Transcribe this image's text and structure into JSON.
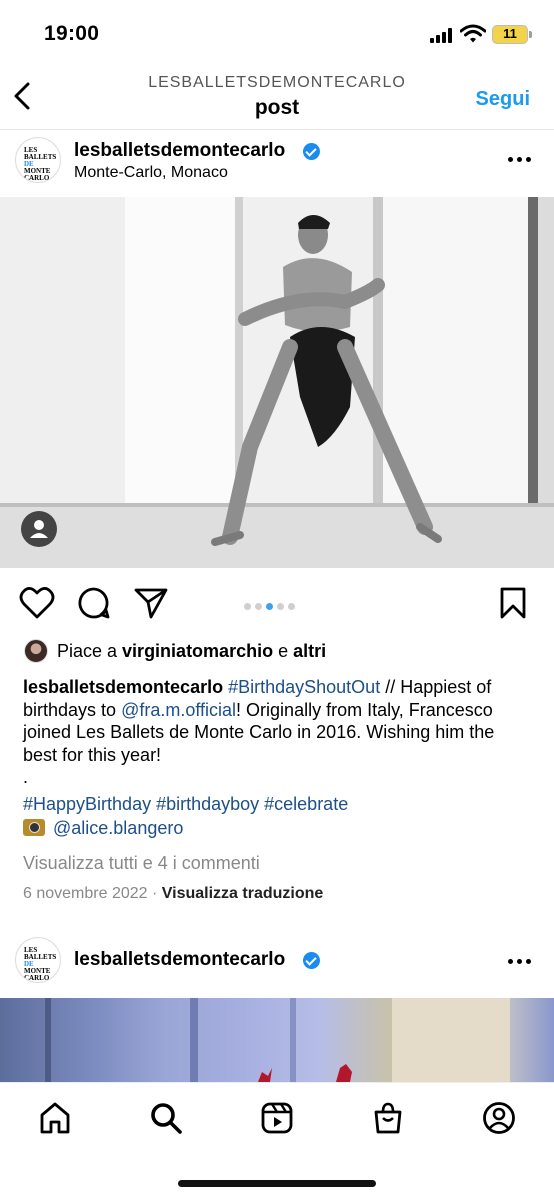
{
  "status": {
    "time": "19:00",
    "battery": "11"
  },
  "header": {
    "subtitle": "LESBALLETSDEMONTECARLO",
    "title": "post",
    "follow": "Segui"
  },
  "post": {
    "username": "lesballetsdemontecarlo",
    "location": "Monte-Carlo, Monaco",
    "logo": [
      "LES",
      "BALLETS",
      "DE",
      "MONTE",
      "CARLO"
    ],
    "carousel": {
      "count": 5,
      "active": 2
    },
    "likes": {
      "prefix": "Piace a ",
      "user": "virginiatomarchio",
      "middle": " e ",
      "others": "altri"
    },
    "caption": {
      "user": "lesballetsdemontecarlo",
      "hashtag1": "#BirthdayShoutOut",
      "text1": " // Happiest of birthdays to ",
      "mention": "@fra.m.official",
      "text2": "! Originally from Italy, Francesco joined Les Ballets de Monte Carlo in 2016. Wishing him the best for this year!",
      "dot": "."
    },
    "tags": "#HappyBirthday #birthdayboy #celebrate",
    "photo_credit": "@alice.blangero",
    "view_comments": "Visualizza tutti e 4 i commenti",
    "date": "6 novembre 2022",
    "separator": " · ",
    "translate": "Visualizza traduzione"
  },
  "post2": {
    "username": "lesballetsdemontecarlo"
  },
  "colors": {
    "accent": "#1a9bf0",
    "link": "#1d4f8a",
    "verified": "#1a8cf0",
    "active_dot": "#3ea0f0"
  },
  "tabs": [
    "home-icon",
    "search-icon",
    "reels-icon",
    "shop-icon",
    "profile-icon"
  ]
}
